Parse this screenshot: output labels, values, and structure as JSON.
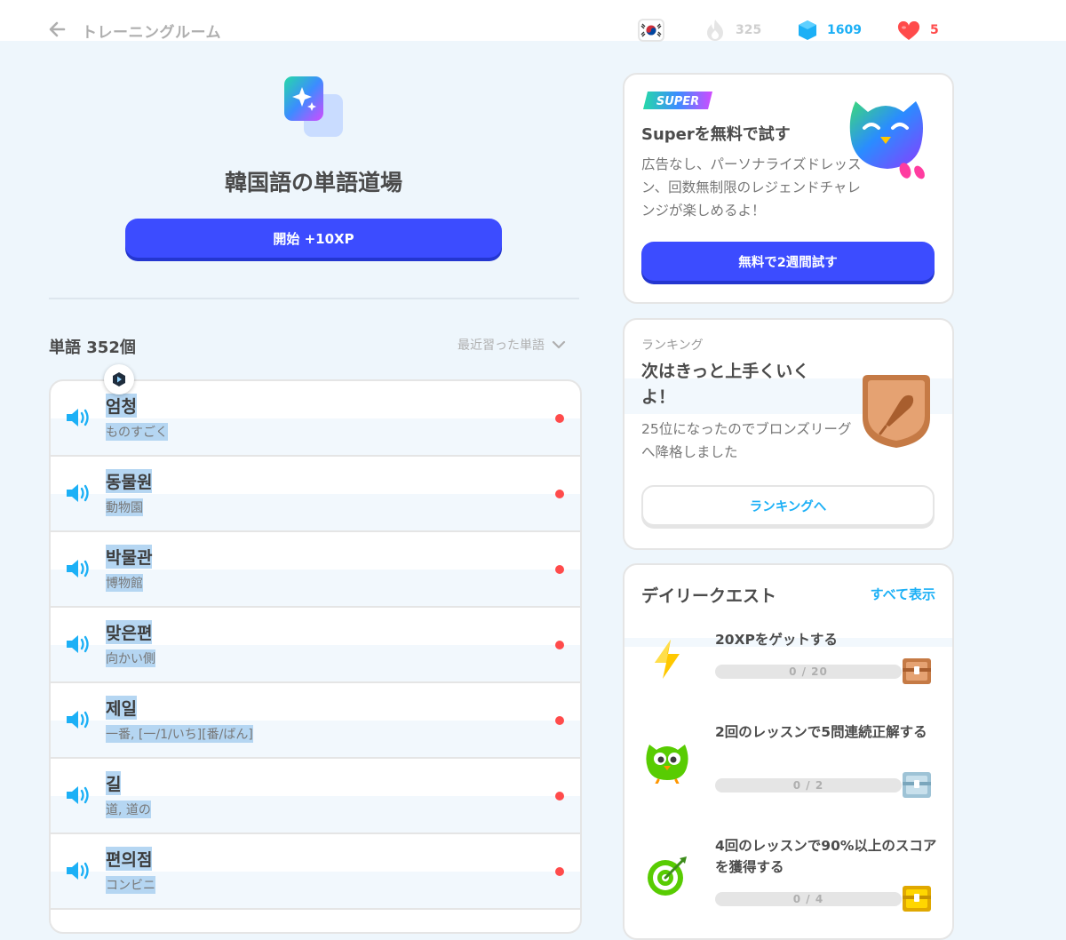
{
  "header": {
    "title": "トレーニングルーム",
    "streak": "325",
    "gems": "1609",
    "hearts": "5",
    "icons": [
      "back-arrow-icon",
      "korea-flag-icon",
      "flame-icon",
      "gem-icon",
      "heart-icon"
    ]
  },
  "practice": {
    "title": "韓国語の単語道場",
    "start_label": "開始 +10XP"
  },
  "words": {
    "heading": "単語 352個",
    "sort_label": "最近習った単語",
    "items": [
      {
        "ko": "엄청",
        "ja": "ものすごく"
      },
      {
        "ko": "동물원",
        "ja": "動物園"
      },
      {
        "ko": "박물관",
        "ja": "博物館"
      },
      {
        "ko": "맞은편",
        "ja": "向かい側"
      },
      {
        "ko": "제일",
        "ja": "一番, [一/1/いち][番/ばん]"
      },
      {
        "ko": "길",
        "ja": "道, 道の"
      },
      {
        "ko": "편의점",
        "ja": "コンビニ"
      }
    ]
  },
  "super": {
    "badge": "SUPER",
    "title": "Superを無料で試す",
    "desc": "広告なし、パーソナライズドレッスン、回数無制限のレジェンドチャレンジが楽しめるよ！",
    "button": "無料で2週間試す"
  },
  "ranking": {
    "label": "ランキング",
    "title": "次はきっと上手くいくよ！",
    "desc": "25位になったのでブロンズリーグへ降格しました",
    "button": "ランキングへ"
  },
  "quests": {
    "title": "デイリークエスト",
    "show_all": "すべて表示",
    "items": [
      {
        "text": "20XPをゲットする",
        "progress": "0 / 20",
        "fraction": 0,
        "icon": "lightning-icon"
      },
      {
        "text": "2回のレッスンで5問連続正解する",
        "progress": "0 / 2",
        "fraction": 0,
        "icon": "owl-icon"
      },
      {
        "text": "4回のレッスンで90%以上のスコアを獲得する",
        "progress": "0 / 4",
        "fraction": 0,
        "icon": "target-icon"
      }
    ]
  },
  "colors": {
    "accent": "#3c4cff",
    "link": "#1cb0f6",
    "heart": "#ff4b4b",
    "background": "#eef6fc"
  }
}
